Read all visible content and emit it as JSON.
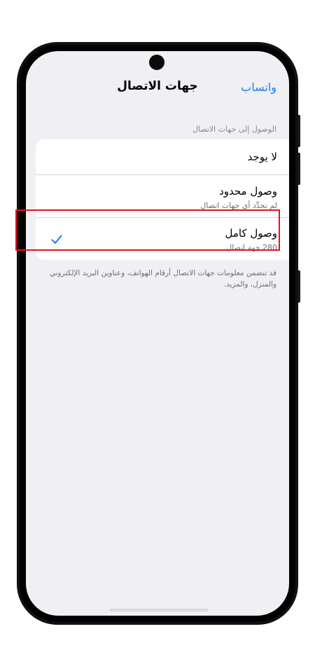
{
  "nav": {
    "title": "جهات الاتصال",
    "back_label": "واتساب"
  },
  "section": {
    "header": "الوصول إلى جهات الاتصال"
  },
  "options": [
    {
      "title": "لا يوجد",
      "subtitle": "",
      "selected": false
    },
    {
      "title": "وصول محدود",
      "subtitle": "لم تحدِّد أي جهات اتصال",
      "selected": false
    },
    {
      "title": "وصول كامل",
      "subtitle": "280 جهة اتصال",
      "selected": true
    }
  ],
  "footer": {
    "note": "قد تتضمن معلومات جهات الاتصال أرقام الهواتف، وعناوين البريد الإلكتروني والمنزل، والمزيد."
  },
  "colors": {
    "accent": "#1a7ee8",
    "highlight": "#e5121f",
    "background": "#efeff4"
  },
  "icons": {
    "selected": "checkmark-icon"
  }
}
